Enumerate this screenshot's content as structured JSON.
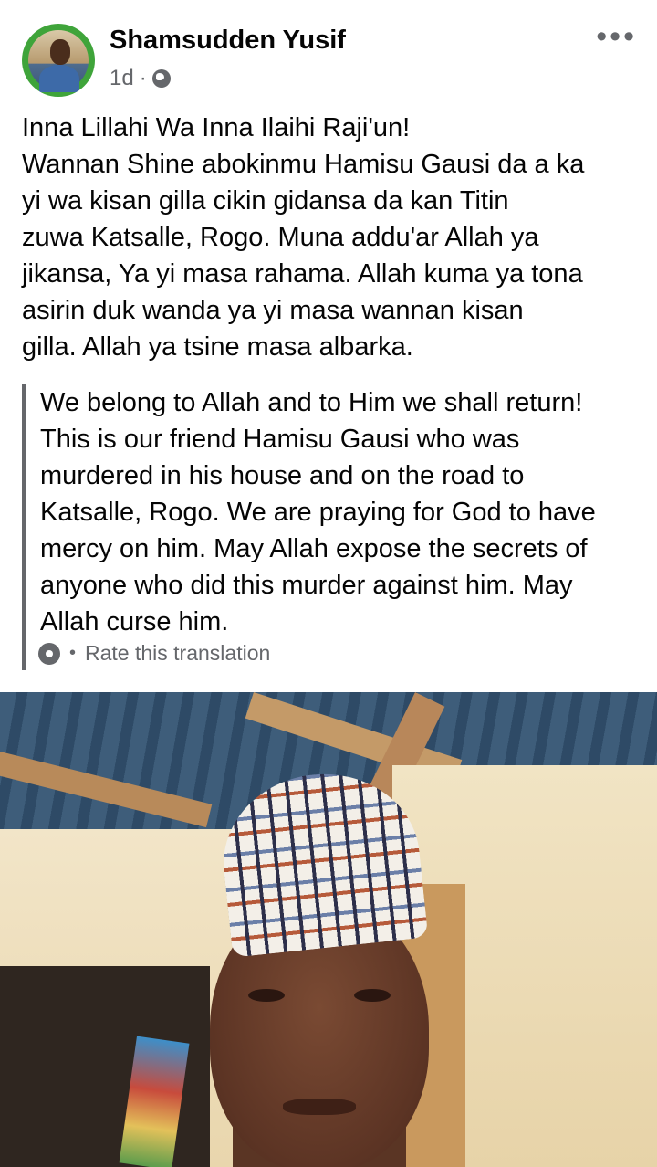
{
  "post": {
    "author": "Shamsudden Yusif",
    "time": "1d",
    "separator": "·",
    "privacy_icon": "globe-icon",
    "more_label": "•••",
    "text_lines": [
      "Inna Lillahi Wa Inna Ilaihi Raji'un!",
      "Wannan Shine abokinmu Hamisu Gausi da a ka",
      "yi wa kisan gilla cikin gidansa da kan Titin",
      "zuwa Katsalle, Rogo. Muna addu'ar Allah ya",
      "jikansa, Ya yi masa rahama. Allah kuma ya tona",
      "asirin duk wanda ya yi masa wannan kisan",
      "gilla. Allah ya tsine masa albarka."
    ]
  },
  "translation": {
    "lines": [
      "We belong to Allah and to Him we shall return!",
      "This is our friend Hamisu Gausi who was",
      "murdered in his house and on the road to",
      "Katsalle, Rogo. We are praying for God to have",
      "mercy on him. May Allah expose the secrets of",
      "anyone who did this murder against him. May",
      "Allah curse him."
    ],
    "rate_icon": "gear-icon",
    "rate_separator": "•",
    "rate_label": "Rate this translation"
  },
  "colors": {
    "secondary_text": "#65676b",
    "avatar_ring": "#3fa43a"
  }
}
